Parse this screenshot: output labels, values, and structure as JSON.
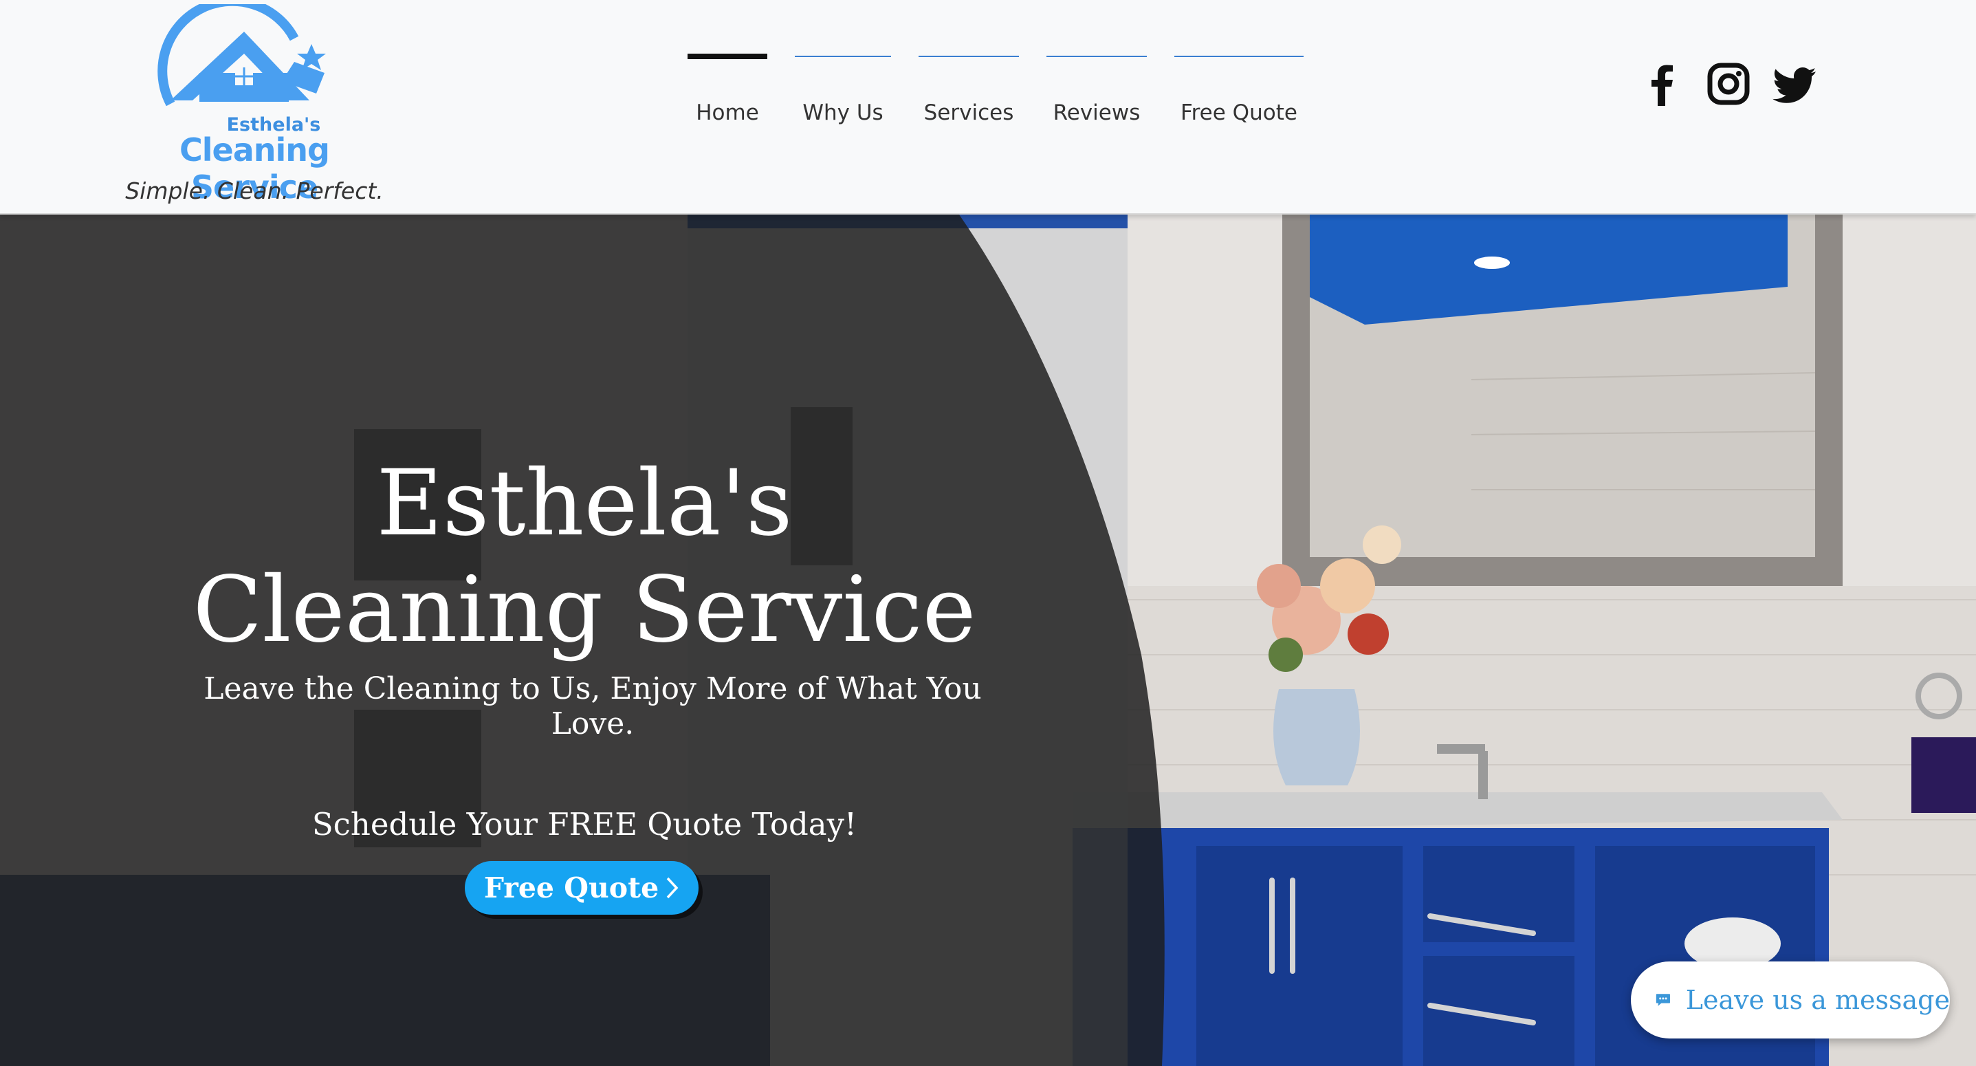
{
  "logo": {
    "script_text": "Esthela's",
    "name": "Cleaning Service",
    "tagline": "Simple. Clean. Perfect."
  },
  "nav": {
    "items": [
      {
        "label": "Home",
        "active": true
      },
      {
        "label": "Why Us",
        "active": false
      },
      {
        "label": "Services",
        "active": false
      },
      {
        "label": "Reviews",
        "active": false
      },
      {
        "label": "Free Quote",
        "active": false
      }
    ]
  },
  "social": [
    "facebook-icon",
    "instagram-icon",
    "twitter-icon"
  ],
  "hero": {
    "title_line1": "Esthela's",
    "title_line2": "Cleaning Service",
    "subtitle": "Leave the Cleaning to Us, Enjoy More of What You Love.",
    "cta_text": "Schedule Your FREE Quote Today!",
    "button_label": "Free Quote"
  },
  "chat": {
    "label": "Leave us a message"
  },
  "colors": {
    "accent": "#16a4f2",
    "brand": "#4a9ff0",
    "vanity_blue": "#1e47a8",
    "overlay": "#1e1e1e"
  }
}
